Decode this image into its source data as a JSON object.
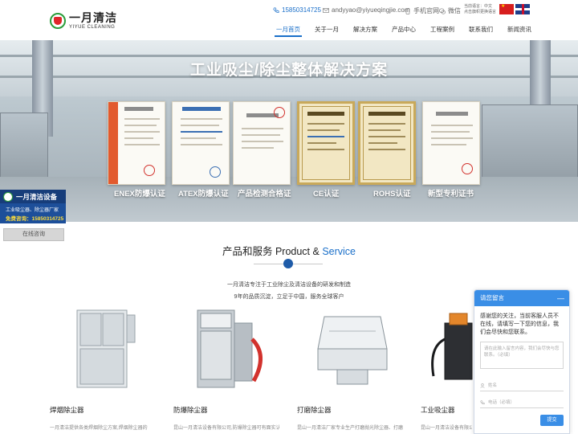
{
  "header": {
    "logo_cn": "一月清洁",
    "logo_en": "YIYUE CLEANING",
    "phone": "15850314725",
    "email": "andyyao@yiyueqingjie.com",
    "mobile_site": "手机官网",
    "wechat": "微信",
    "lang_current": "当前语言：中文",
    "lang_hint": "点击旗帜更换语言"
  },
  "nav": [
    {
      "label": "一月首页",
      "active": true
    },
    {
      "label": "关于一月",
      "active": false
    },
    {
      "label": "解决方案",
      "active": false
    },
    {
      "label": "产品中心",
      "active": false
    },
    {
      "label": "工程案例",
      "active": false
    },
    {
      "label": "联系我们",
      "active": false
    },
    {
      "label": "新闻资讯",
      "active": false
    }
  ],
  "hero": {
    "title": "工业吸尘/除尘整体解决方案",
    "certs": [
      {
        "label": "ENEX防爆认证",
        "style": "band"
      },
      {
        "label": "ATEX防爆认证",
        "style": "plain"
      },
      {
        "label": "产品检测合格证",
        "style": "plain"
      },
      {
        "label": "CE认证",
        "style": "gold"
      },
      {
        "label": "ROHS认证",
        "style": "gold"
      },
      {
        "label": "新型专利证书",
        "style": "plain"
      }
    ]
  },
  "left_ad": {
    "title": "一月清洁设备",
    "subtitle": "工业吸尘器、除尘器厂家",
    "hotline": "免费咨询：15850314725",
    "online_btn": "在线咨询"
  },
  "section": {
    "title_cn": "产品和服务 Product &",
    "title_en": "Service",
    "desc_line1": "一月清洁专注于工业除尘及清洁设备的研发和制造",
    "desc_line2": "9年的品质沉淀，立足于中国，服务全球客户"
  },
  "products": [
    {
      "name": "焊烟除尘器",
      "desc": "一月清洁提供各类焊烟除尘方案,焊烟除尘器的"
    },
    {
      "name": "防爆除尘器",
      "desc": "昆山一月清洁设备有限公司,防爆除尘器可有面实认"
    },
    {
      "name": "打磨除尘器",
      "desc": "昆山一月清洁厂家专业生产打磨抛光除尘器、打磨"
    },
    {
      "name": "工业吸尘器",
      "desc": "昆山一月清洁设备有限公司"
    }
  ],
  "chat": {
    "title": "请您留言",
    "minimize": "—",
    "message": "感谢您的关注，当前客服人员不在线，请填写一下您的信息，我们会尽快和您联系。",
    "textarea_placeholder": "请在此输入留言内容，我们会尽快与您联系。（必填）",
    "name_placeholder": "姓名",
    "phone_placeholder": "电话（必填）",
    "submit": "提交"
  },
  "colors": {
    "brand_blue": "#1a6fc9",
    "chat_blue": "#3a8ee6",
    "logo_green": "#2a9d3a",
    "logo_red": "#e0262b"
  }
}
